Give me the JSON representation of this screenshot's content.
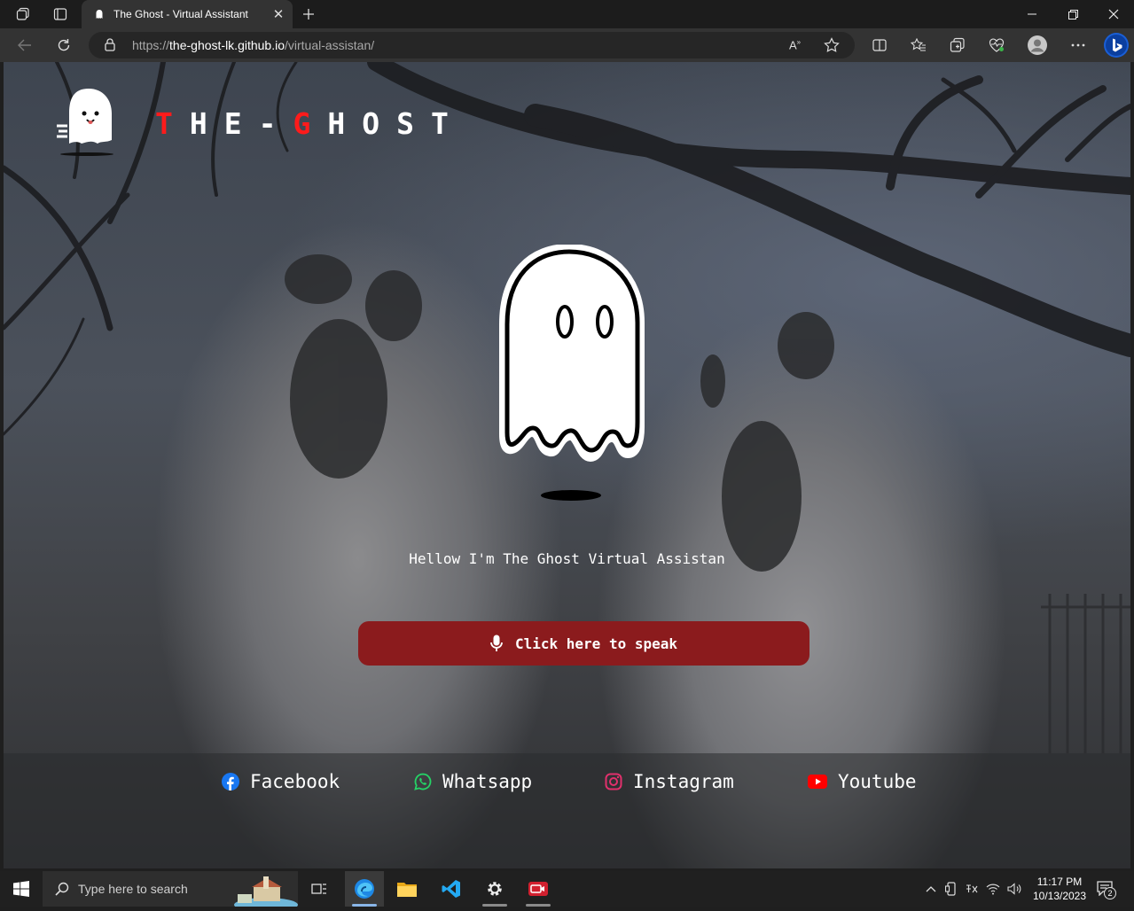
{
  "browser": {
    "tab_title": "The Ghost - Virtual Assistant",
    "url_prefix": "https://",
    "url_domain": "the-ghost-lk.github.io",
    "url_path": "/virtual-assistan/"
  },
  "site": {
    "brand_t": "T",
    "brand_he": "HE-",
    "brand_g": "G",
    "brand_host": "HOST",
    "greeting": "Hellow I'm The Ghost Virtual Assistan",
    "speak_label": "Click here to speak",
    "social": [
      {
        "label": "Facebook",
        "icon": "facebook-icon",
        "color": "#1877f2"
      },
      {
        "label": "Whatsapp",
        "icon": "whatsapp-icon",
        "color": "#25d366"
      },
      {
        "label": "Instagram",
        "icon": "instagram-icon",
        "color": "#e1306c"
      },
      {
        "label": "Youtube",
        "icon": "youtube-icon",
        "color": "#ff0000"
      }
    ],
    "accent": "#ff1b1b",
    "button_color": "#8b1b1d"
  },
  "taskbar": {
    "search_placeholder": "Type here to search",
    "time": "11:17 PM",
    "date": "10/13/2023",
    "notification_count": "2"
  }
}
